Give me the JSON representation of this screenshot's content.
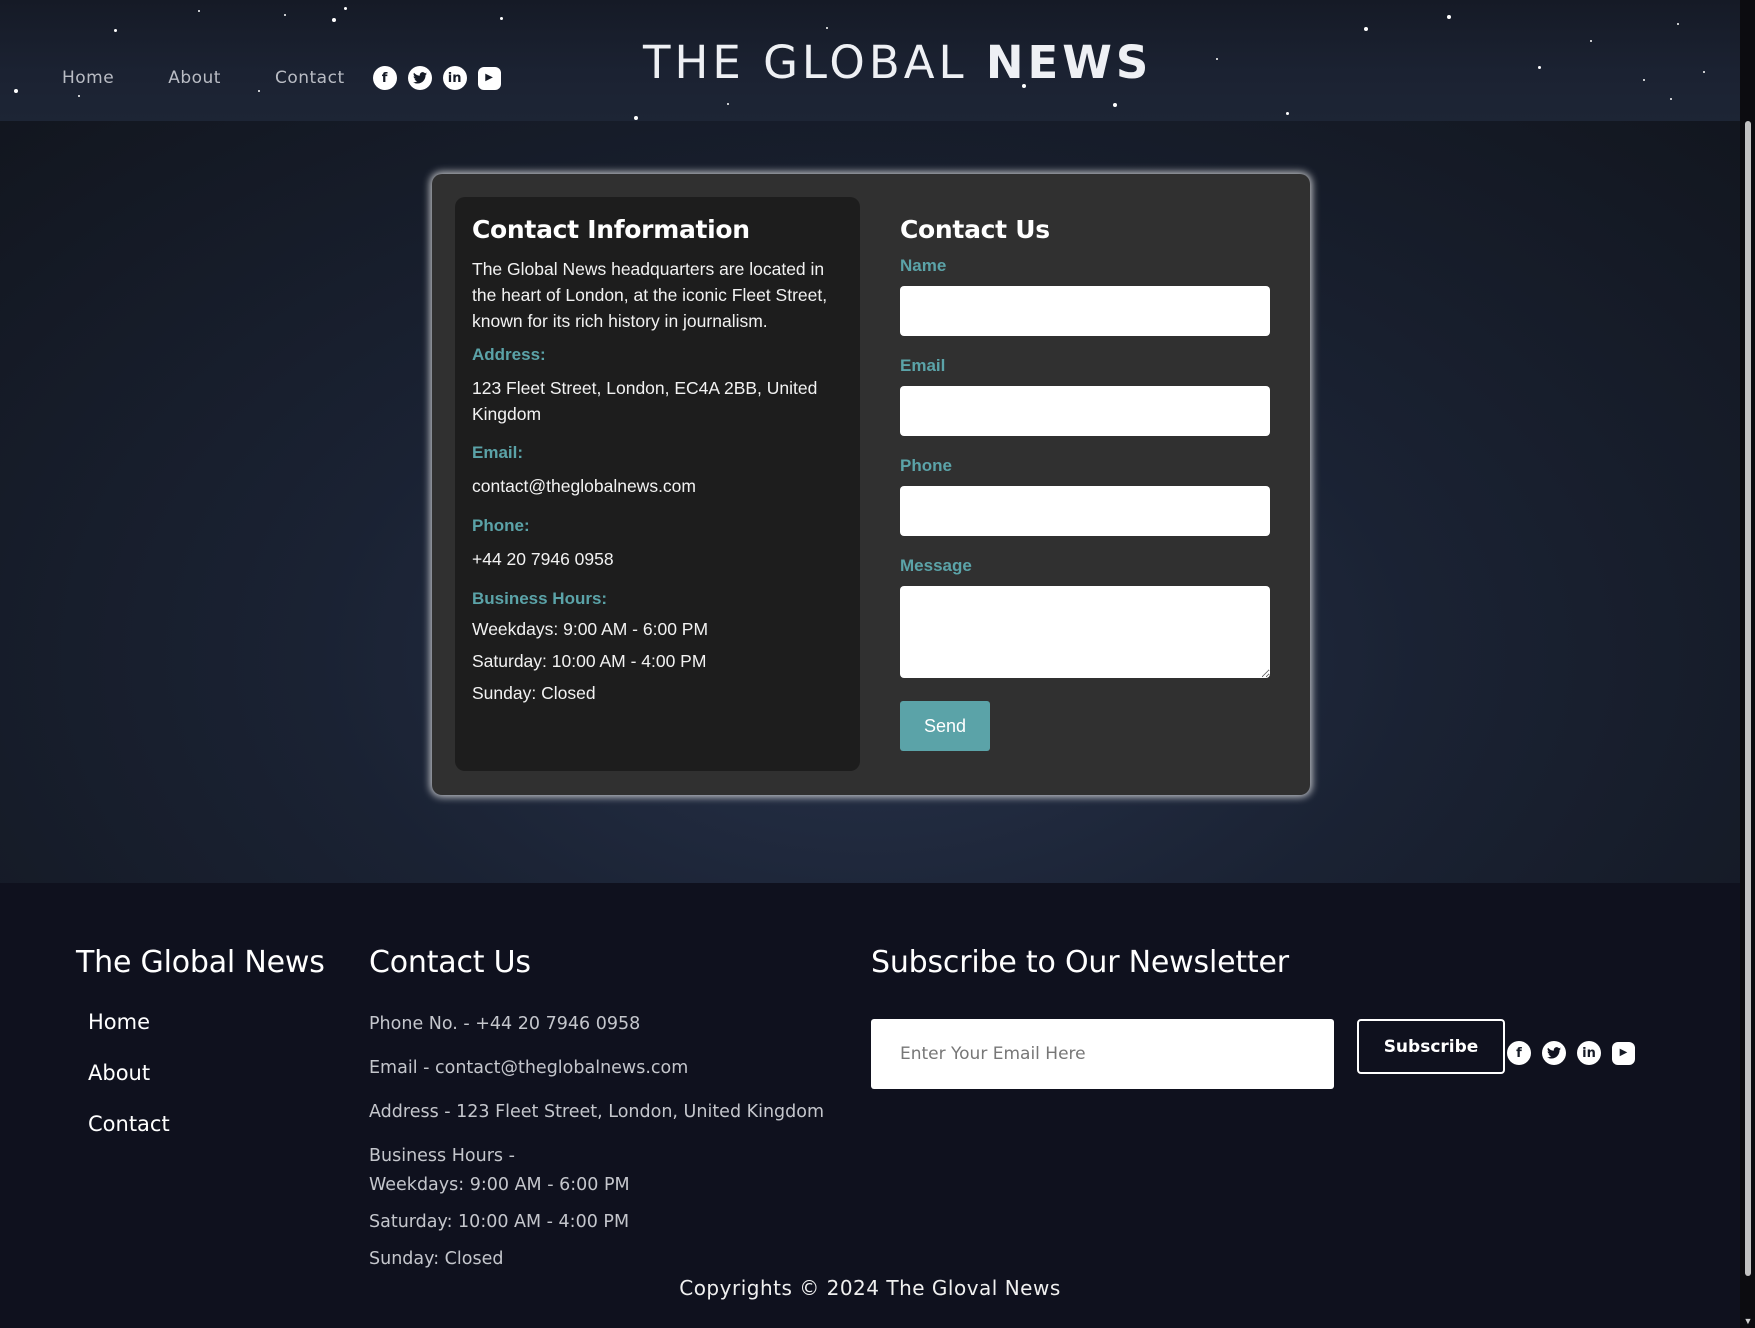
{
  "header": {
    "nav": [
      "Home",
      "About",
      "Contact"
    ],
    "social_icons": [
      "facebook-icon",
      "twitter-icon",
      "linkedin-icon",
      "youtube-icon"
    ],
    "logo_light": "THE GLOBAL ",
    "logo_bold": "NEWS"
  },
  "info": {
    "title": "Contact Information",
    "description": "The Global News headquarters are located in the heart of London, at the iconic Fleet Street, known for its rich history in journalism.",
    "address_label": "Address:",
    "address": "123 Fleet Street, London, EC4A 2BB, United Kingdom",
    "email_label": "Email:",
    "email": "contact@theglobalnews.com",
    "phone_label": "Phone:",
    "phone": "+44 20 7946 0958",
    "hours_label": "Business Hours:",
    "hours": [
      "Weekdays: 9:00 AM - 6:00 PM",
      "Saturday: 10:00 AM - 4:00 PM",
      "Sunday: Closed"
    ]
  },
  "form": {
    "title": "Contact Us",
    "name_label": "Name",
    "email_label": "Email",
    "phone_label": "Phone",
    "message_label": "Message",
    "send_label": "Send"
  },
  "footer": {
    "brand": "The Global News",
    "links": [
      "Home",
      "About",
      "Contact"
    ],
    "contact_title": "Contact Us",
    "phone": "Phone No. - +44 20 7946 0958",
    "email": "Email - contact@theglobalnews.com",
    "address": "Address - 123 Fleet Street, London, United Kingdom",
    "hours_label": "Business Hours -",
    "hours": [
      "Weekdays: 9:00 AM - 6:00 PM",
      "Saturday: 10:00 AM - 4:00 PM",
      "Sunday: Closed"
    ],
    "newsletter_title": "Subscribe to Our Newsletter",
    "newsletter_placeholder": "Enter Your Email Here",
    "subscribe_label": "Subscribe",
    "copyright": "Copyrights © 2024 The Gloval News"
  },
  "colors": {
    "accent": "#5ba3a8",
    "card": "#303030",
    "info_panel": "#1d1d1d",
    "footer_bg": "#0f111e"
  }
}
